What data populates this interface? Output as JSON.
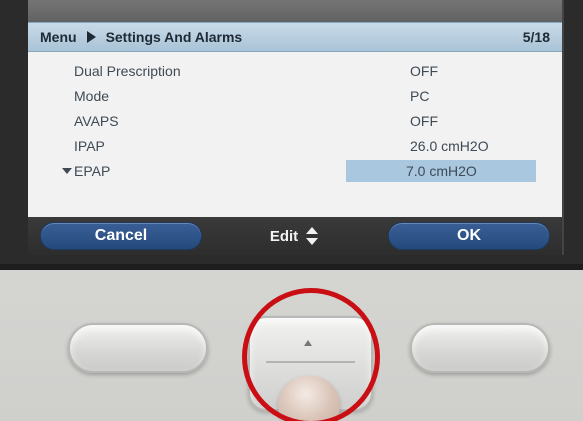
{
  "title_bar": {
    "menu": "Menu",
    "section": "Settings And Alarms",
    "page": "5/18"
  },
  "settings": [
    {
      "label": "Dual Prescription",
      "value": "OFF"
    },
    {
      "label": "Mode",
      "value": "PC"
    },
    {
      "label": "AVAPS",
      "value": "OFF"
    },
    {
      "label": "IPAP",
      "value": "26.0 cmH2O"
    },
    {
      "label": "EPAP",
      "value": "7.0 cmH2O"
    }
  ],
  "softkeys": {
    "cancel": "Cancel",
    "edit": "Edit",
    "ok": "OK"
  },
  "colors": {
    "title_bar": "#a9c3d6",
    "selected_value_bg": "#a9c7de",
    "softkey_blue": "#2f5890",
    "highlight_ring": "#c90f14"
  },
  "icons": {
    "breadcrumb_separator": "right-triangle-icon",
    "more_below": "down-triangle-icon",
    "edit": "up-down-arrows-icon"
  }
}
